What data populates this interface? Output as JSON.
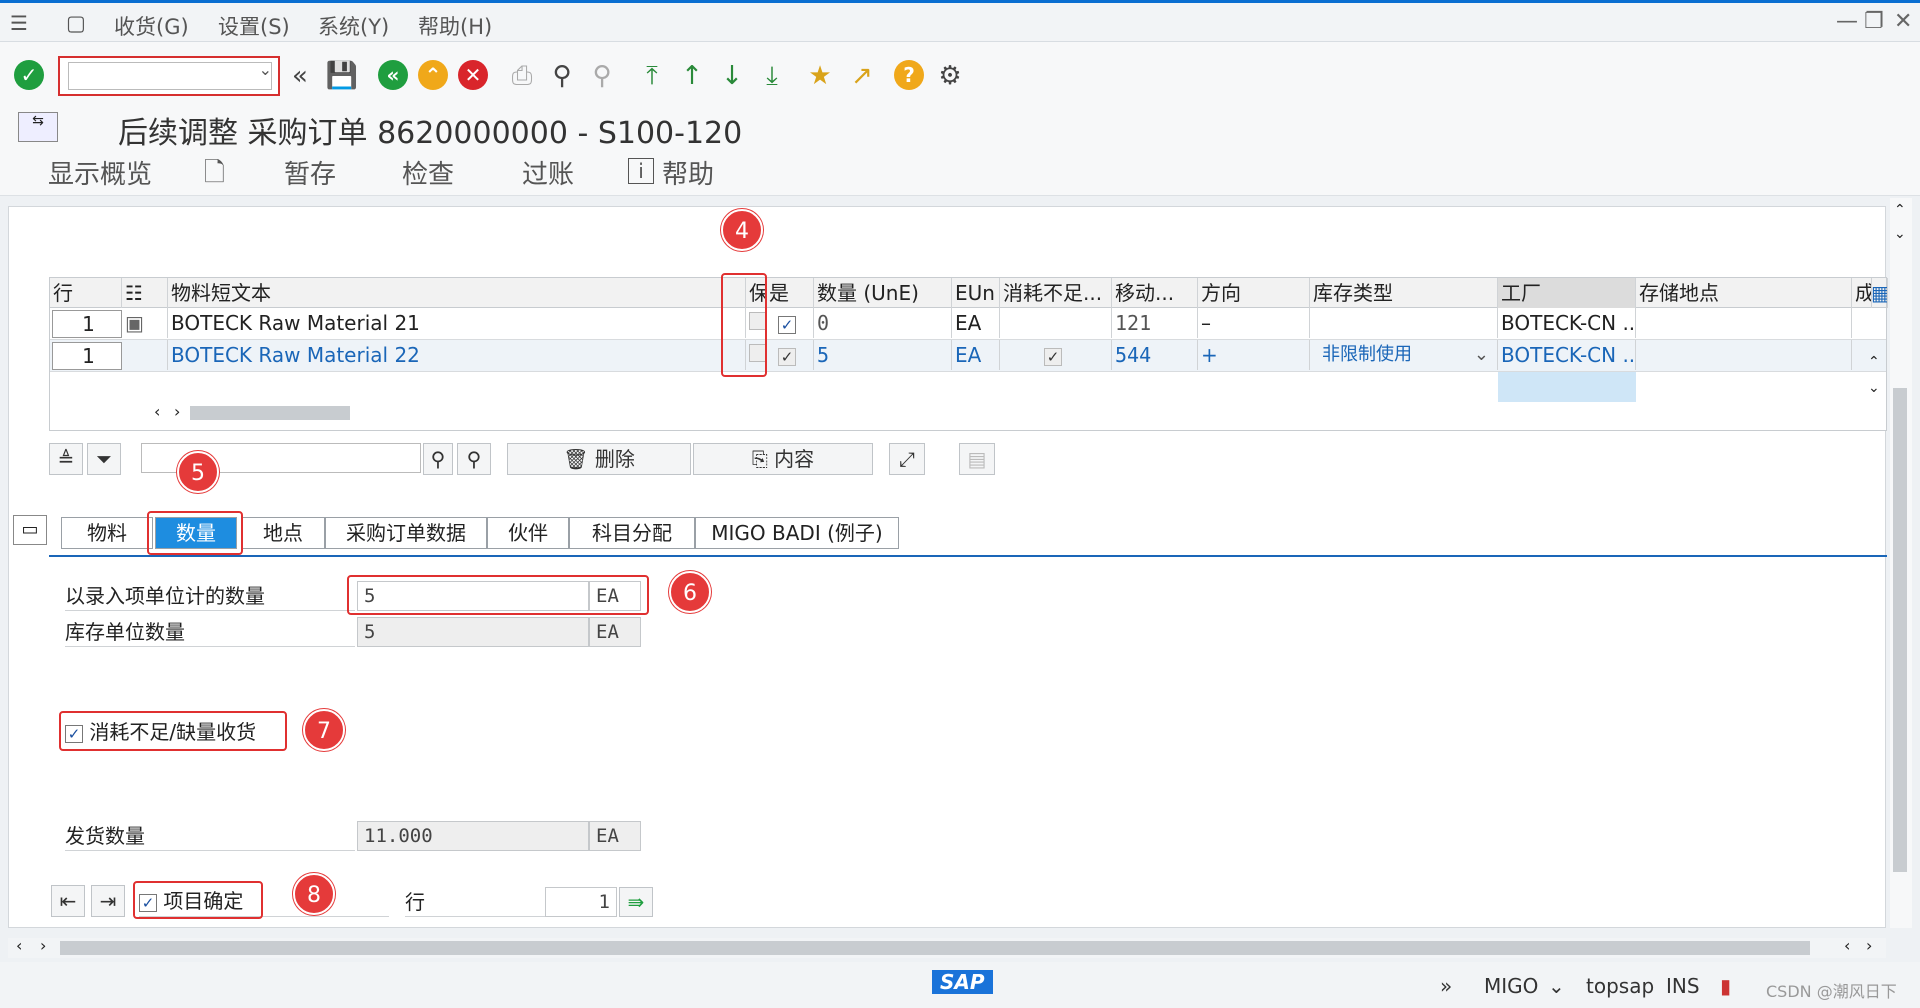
{
  "menu": {
    "items": [
      "收货(G)",
      "设置(S)",
      "系统(Y)",
      "帮助(H)"
    ]
  },
  "toolbar": {
    "command_value": ""
  },
  "title": "后续调整 采购订单 8620000000 - S100-120",
  "appbar": {
    "overview": "显示概览",
    "save_draft": "暂存",
    "check": "检查",
    "post": "过账",
    "help": "帮助"
  },
  "grid": {
    "columns": [
      "行",
      "物料短文本",
      "保",
      "是",
      "数量 (UnE)",
      "EUn",
      "消耗不足...",
      "移动...",
      "方向",
      "库存类型",
      "工厂",
      "存储地点",
      "成本"
    ],
    "rows": [
      {
        "line": "1",
        "text": "BOTECK Raw Material 21",
        "qty": "0",
        "unit": "EA",
        "mvt": "121",
        "dir": "–",
        "stock": "",
        "plant": "BOTECK-CN ..."
      },
      {
        "line": "1",
        "text": "BOTECK Raw Material 22",
        "qty": "5",
        "unit": "EA",
        "mvt": "544",
        "dir": "+",
        "stock": "非限制使用",
        "plant": "BOTECK-CN ..."
      }
    ]
  },
  "buttons": {
    "delete": "删除",
    "contents": "内容"
  },
  "tabs": [
    "物料",
    "数量",
    "地点",
    "采购订单数据",
    "伙伴",
    "科目分配",
    "MIGO BADI (例子)"
  ],
  "detail": {
    "qty_entry_label": "以录入项单位计的数量",
    "qty_entry_value": "5",
    "qty_entry_unit": "EA",
    "qty_stock_label": "库存单位数量",
    "qty_stock_value": "5",
    "qty_stock_unit": "EA",
    "underdelivery_label": "消耗不足/缺量收货",
    "delivery_qty_label": "发货数量",
    "delivery_qty_value": "11.000",
    "delivery_qty_unit": "EA",
    "item_ok_label": "项目确定",
    "line_label": "行",
    "line_value": "1"
  },
  "badges": [
    "4",
    "5",
    "6",
    "7",
    "8"
  ],
  "status": {
    "tcode": "MIGO",
    "server": "topsap",
    "mode": "INS",
    "brand": "SAP",
    "watermark": "CSDN @潮风日下"
  },
  "colors": {
    "accent": "#1e8de0",
    "annotation": "#e53a3a",
    "ok_green": "#1f9e3f",
    "cancel_red": "#d9252b",
    "warning_orange": "#f0a81a"
  }
}
